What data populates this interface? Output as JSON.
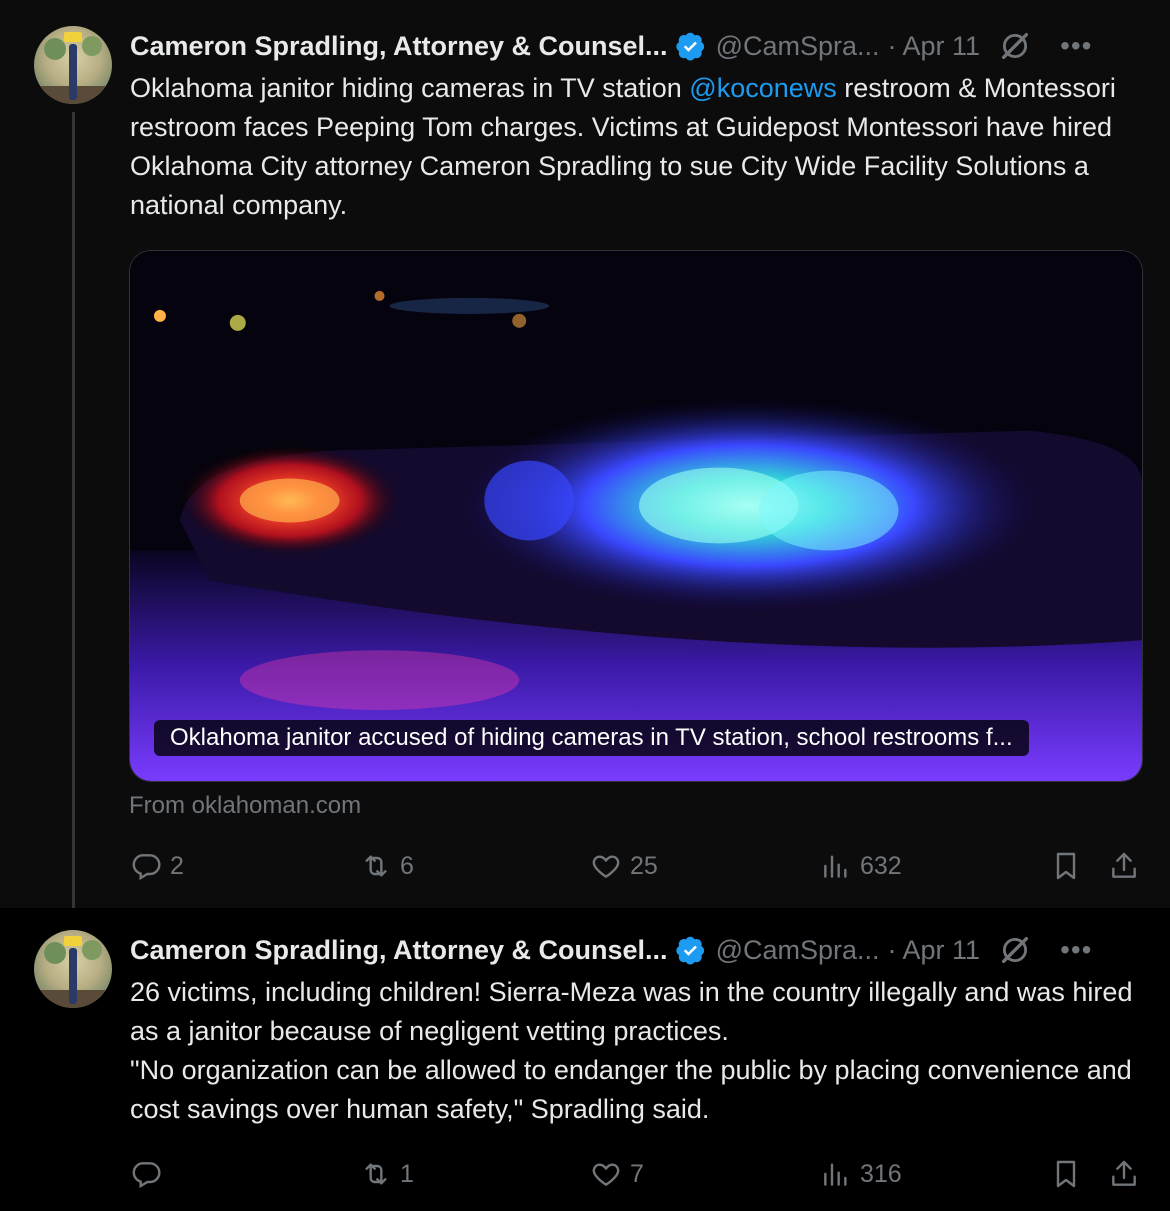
{
  "tweets": [
    {
      "author": "Cameron Spradling, Attorney & Counsel...",
      "handle": "@CamSpra...",
      "date": "· Apr 11",
      "text_before": "Oklahoma janitor hiding cameras in TV station ",
      "mention": "@koconews",
      "text_after": " restroom & Montessori restroom faces Peeping Tom charges. Victims at Guidepost Montessori have hired Oklahoma City attorney Cameron Spradling to sue City Wide Facility Solutions a national company.",
      "card": {
        "caption": "Oklahoma janitor accused of hiding cameras in TV station, school restrooms f...",
        "source": "From oklahoman.com"
      },
      "stats": {
        "replies": "2",
        "reposts": "6",
        "likes": "25",
        "views": "632"
      }
    },
    {
      "author": "Cameron Spradling, Attorney & Counsel...",
      "handle": "@CamSpra...",
      "date": "· Apr 11",
      "text": "26 victims, including children!  Sierra-Meza was in the country illegally and was hired as a janitor because of negligent vetting practices.\n\"No organization can be allowed to endanger the public by placing convenience and cost savings over human safety,\" Spradling said.",
      "stats": {
        "replies": "",
        "reposts": "1",
        "likes": "7",
        "views": "316"
      }
    }
  ],
  "colors": {
    "accent": "#1d9bf0",
    "muted": "#71767b",
    "text": "#e7e9ea"
  },
  "icons": [
    "verified-badge-icon",
    "grok-icon",
    "more-icon",
    "reply-icon",
    "repost-icon",
    "like-icon",
    "views-icon",
    "bookmark-icon",
    "share-icon"
  ]
}
